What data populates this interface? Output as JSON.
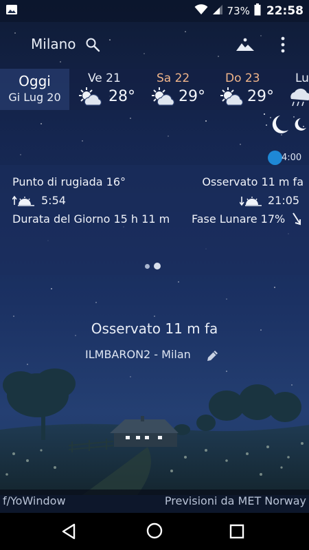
{
  "status_bar": {
    "battery_percent": "73%",
    "time": "22:58",
    "icons": [
      "image-icon",
      "wifi-icon",
      "signal-icon",
      "battery-icon"
    ]
  },
  "header": {
    "city": "Milano",
    "icons": [
      "search-icon",
      "landscape-icon",
      "menu-icon"
    ]
  },
  "forecast": {
    "today": {
      "name": "Oggi",
      "date": "Gi Lug 20"
    },
    "days": [
      {
        "name": "Ve 21",
        "temp": "28°",
        "icon": "sun-cloud-icon",
        "name_color": "#e8edf6"
      },
      {
        "name": "Sa 22",
        "temp": "29°",
        "icon": "sun-cloud-icon",
        "name_color": "#f0b58a"
      },
      {
        "name": "Do 23",
        "temp": "29°",
        "icon": "sun-cloud-icon",
        "name_color": "#f0b58a"
      },
      {
        "name": "Lu",
        "temp": "",
        "icon": "rain-cloud-icon",
        "name_color": "#e8edf6"
      }
    ]
  },
  "sun": {
    "time": "4:00"
  },
  "details": {
    "dew_point": "Punto di rugiada 16°",
    "observed": "Osservato 11 m fa",
    "sunrise": "5:54",
    "sunset": "21:05",
    "day_length": "Durata del Giorno 15 h 11 m",
    "moon_phase": "Fase Lunare 17%"
  },
  "observation": {
    "observed": "Osservato 11 m fa",
    "station": "ILMBARON2 - Milan"
  },
  "footer": {
    "left": "f/YoWindow",
    "right": "Previsioni da MET Norway"
  },
  "colors": {
    "accent": "#1e88d6",
    "weekend": "#f0b58a"
  }
}
